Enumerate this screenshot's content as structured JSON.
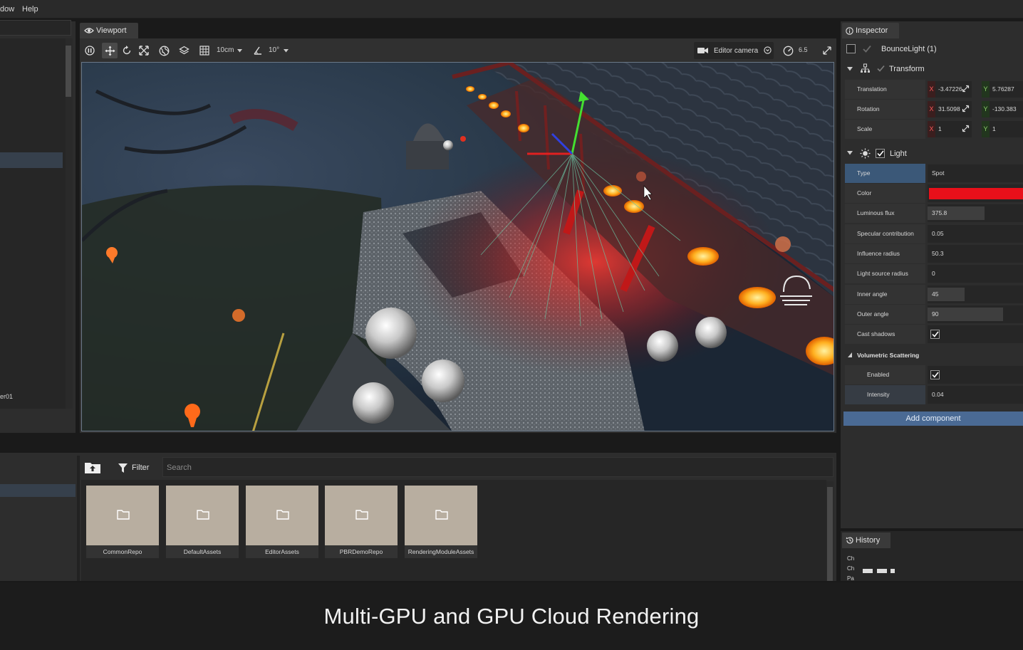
{
  "menu": {
    "items": [
      "dow",
      "Help"
    ]
  },
  "left_panel": {
    "bottom_label": "er01"
  },
  "viewport": {
    "tab_label": "Viewport",
    "grid_size": "10cm",
    "angle_snap": "10°",
    "camera_label": "Editor camera",
    "camera_speed": "6.5"
  },
  "content_browser": {
    "filter_label": "Filter",
    "search_placeholder": "Search",
    "folders": [
      "CommonRepo",
      "DefaultAssets",
      "EditorAssets",
      "PBRDemoRepo",
      "RenderingModuleAssets"
    ]
  },
  "inspector": {
    "tab_label": "Inspector",
    "object_name": "BounceLight (1)",
    "transform": {
      "title": "Transform",
      "rows": [
        {
          "label": "Translation",
          "x": "-3.47226",
          "y": "5.76287"
        },
        {
          "label": "Rotation",
          "x": "31.5098",
          "y": "-130.383"
        },
        {
          "label": "Scale",
          "x": "1",
          "y": "1"
        }
      ]
    },
    "light": {
      "title": "Light",
      "type_label": "Type",
      "type_value": "Spot",
      "color_label": "Color",
      "color_value": "#e8101a",
      "luminous_flux_label": "Luminous flux",
      "luminous_flux_value": "375.8",
      "specular_label": "Specular contribution",
      "specular_value": "0.05",
      "influence_label": "Influence radius",
      "influence_value": "50.3",
      "source_radius_label": "Light source radius",
      "source_radius_value": "0",
      "inner_angle_label": "Inner angle",
      "inner_angle_value": "45",
      "outer_angle_label": "Outer angle",
      "outer_angle_value": "90",
      "cast_shadows_label": "Cast shadows",
      "cast_shadows_checked": true
    },
    "volumetric": {
      "title": "Volumetric Scattering",
      "enabled_label": "Enabled",
      "enabled_checked": true,
      "intensity_label": "Intensity",
      "intensity_value": "0.04"
    },
    "add_component": "Add component"
  },
  "history": {
    "tab_label": "History",
    "entries": [
      "Ch",
      "Ch",
      "Pa"
    ]
  },
  "caption": "Multi-GPU and GPU Cloud Rendering",
  "colors": {
    "accent": "#4a6a94",
    "selection": "#3b5878",
    "light_color": "#e8101a"
  }
}
